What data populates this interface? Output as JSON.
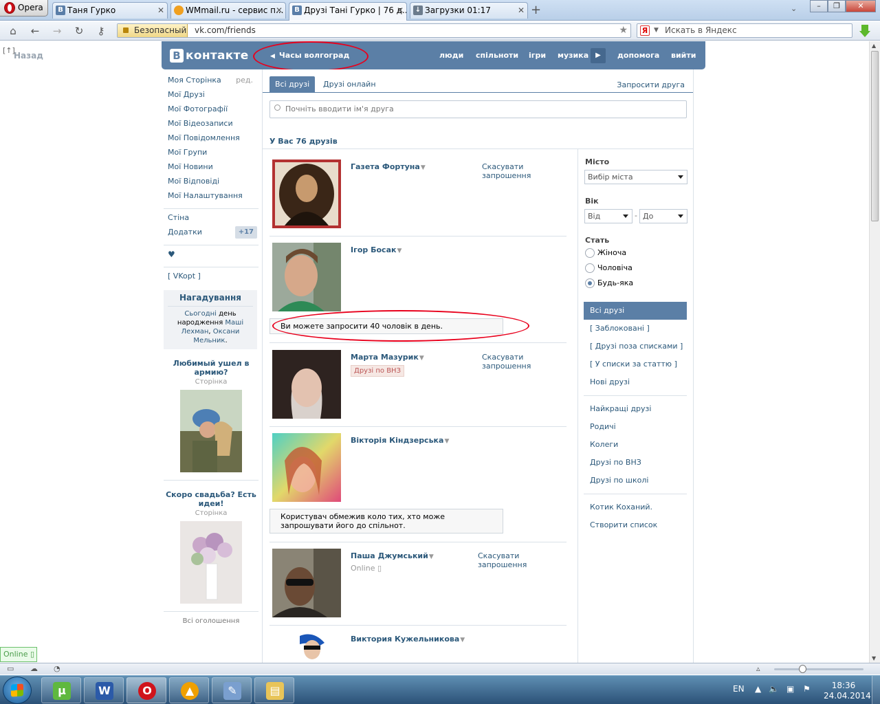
{
  "browser": {
    "menu_label": "Opera",
    "tabs": [
      {
        "label": "Таня Гурко",
        "icon": "vk-icon"
      },
      {
        "label": "WMmail.ru - сервис п...",
        "icon": "wmmail-icon"
      },
      {
        "label": "Друзі Тані Гурко | 76 д...",
        "icon": "vk-icon"
      },
      {
        "label": "Загрузки 01:17",
        "icon": "downloads-icon"
      }
    ],
    "security_label": "Безопасный",
    "url": "vk.com/friends",
    "search_engine_icon": "Я",
    "search_placeholder": "Искать в Яндекс"
  },
  "panel": {
    "toggle": "[↑]",
    "back": "Назад"
  },
  "vk": {
    "logo_letter": "В",
    "logo_text": "контакте",
    "status": "Часы волгоград",
    "nav": [
      "люди",
      "спільноти",
      "ігри",
      "музика",
      "допомога",
      "вийти"
    ],
    "left_menu": [
      {
        "label": "Моя Сторінка",
        "extra": "ред."
      },
      {
        "label": "Мої Друзі"
      },
      {
        "label": "Мої Фотографії"
      },
      {
        "label": "Мої Відеозаписи"
      },
      {
        "label": "Мої Повідомлення"
      },
      {
        "label": "Мої Групи"
      },
      {
        "label": "Мої Новини"
      },
      {
        "label": "Мої Відповіді"
      },
      {
        "label": "Мої Налаштування"
      }
    ],
    "wall": "Стіна",
    "apps": "Додатки",
    "apps_count": "+17",
    "heart": "♥",
    "vkopt": "[ VKopt ]",
    "reminder": {
      "title": "Нагадування",
      "text_before": "Сьогодні",
      "text_mid": "день народження",
      "name1": "Маші Лехман",
      "sep": ",",
      "name2": "Оксани Мельник",
      "end": "."
    },
    "ads": [
      {
        "title": "Любимый ушел в армию?",
        "sub": "Сторінка"
      },
      {
        "title": "Скоро свадьба? Есть идеи!",
        "sub": "Сторінка"
      }
    ],
    "all_ads": "Всі оголошення",
    "tabs": {
      "all": "Всі друзі",
      "online": "Друзі онлайн",
      "invite": "Запросити друга"
    },
    "search_placeholder": "Почніть вводити ім'я друга",
    "summary": "У Вас 76 друзів",
    "friends": [
      {
        "name": "Газета Фортуна",
        "action": "Скасувати запрошення"
      },
      {
        "name": "Ігор Босак",
        "notice": "Ви можете запросити 40 чоловік в день."
      },
      {
        "name": "Марта Мазурик",
        "tag": "Друзі по ВНЗ",
        "action": "Скасувати запрошення"
      },
      {
        "name": "Вікторія Кіндзерська",
        "notice": "Користувач обмежив коло тих, хто може запрошувати його до спільнот."
      },
      {
        "name": "Паша Джумський",
        "online": "Online",
        "action": "Скасувати запрошення"
      },
      {
        "name": "Виктория Кужельникова"
      }
    ],
    "filters": {
      "city_label": "Місто",
      "city_value": "Вибір міста",
      "age_label": "Вік",
      "age_from": "Від",
      "age_dash": "-",
      "age_to": "До",
      "sex_label": "Стать",
      "sex_options": [
        "Жіноча",
        "Чоловіча",
        "Будь-яка"
      ],
      "sex_selected": "Будь-яка",
      "lists1": [
        "Всі друзі",
        "[ Заблоковані ]",
        "[ Друзі поза списками ]",
        "[ У списки за статтю ]",
        "Нові друзі"
      ],
      "lists2": [
        "Найкращі друзі",
        "Родичі",
        "Колеги",
        "Друзі по ВНЗ",
        "Друзі по школі"
      ],
      "lists3": [
        "Котик Коханий.",
        "Створити список"
      ]
    }
  },
  "statusbar": {
    "online": "Online"
  },
  "taskbar": {
    "lang": "EN",
    "time": "18:36",
    "date": "24.04.2014"
  },
  "colors": {
    "vk_blue": "#5b7fa6",
    "link": "#2b587a",
    "annotation_red": "#e8001c"
  }
}
